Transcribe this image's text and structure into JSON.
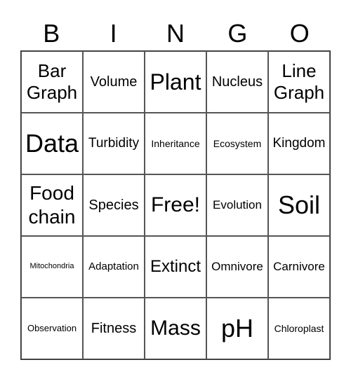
{
  "header": [
    "B",
    "I",
    "N",
    "G",
    "O"
  ],
  "cells": [
    "Bar Graph",
    "Volume",
    "Plant",
    "Nucleus",
    "Line Graph",
    "Data",
    "Turbidity",
    "Inheritance",
    "Ecosystem",
    "Kingdom",
    "Food chain",
    "Species",
    "Free!",
    "Evolution",
    "Soil",
    "Mitochondria",
    "Adaptation",
    "Extinct",
    "Omnivore",
    "Carnivore",
    "Observation",
    "Fitness",
    "Mass",
    "pH",
    "Chloroplast"
  ]
}
